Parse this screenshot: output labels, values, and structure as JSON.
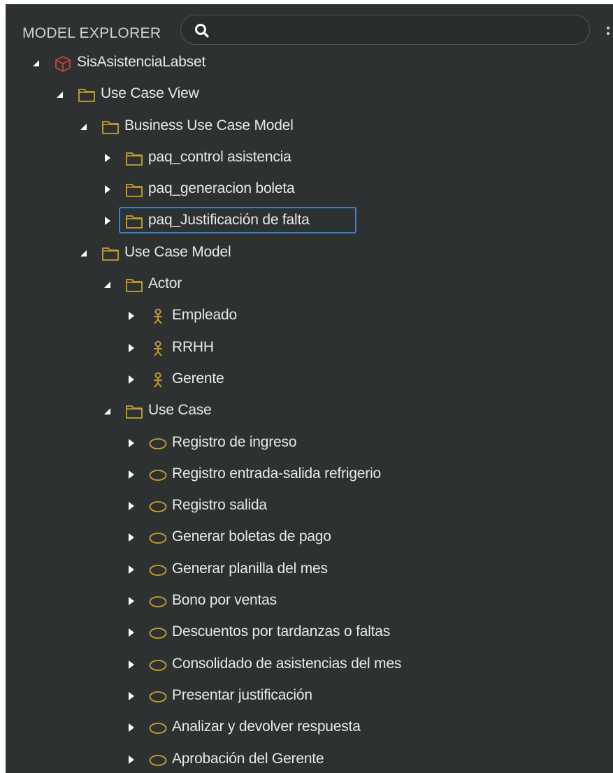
{
  "header": {
    "title": "MODEL EXPLORER",
    "search": {
      "value": "",
      "placeholder": ""
    }
  },
  "colors": {
    "panel_bg": "#2e3132",
    "folder": "#c9a227",
    "actor": "#c9a227",
    "use_case": "#c9a227",
    "project": "#d0453a",
    "selection": "#3a82c8"
  },
  "tree": [
    {
      "label": "SisAsistenciaLabset",
      "icon": "project-icon",
      "depth": 0,
      "expanded": true
    },
    {
      "label": "Use Case View",
      "icon": "folder-icon",
      "depth": 1,
      "expanded": true
    },
    {
      "label": "Business Use Case Model",
      "icon": "folder-icon",
      "depth": 2,
      "expanded": true
    },
    {
      "label": "paq_control asistencia",
      "icon": "folder-icon",
      "depth": 3,
      "expanded": false
    },
    {
      "label": "paq_generacion boleta",
      "icon": "folder-icon",
      "depth": 3,
      "expanded": false
    },
    {
      "label": "paq_Justificación de falta",
      "icon": "folder-icon",
      "depth": 3,
      "expanded": false,
      "selected": true
    },
    {
      "label": "Use Case Model",
      "icon": "folder-icon",
      "depth": 2,
      "expanded": true
    },
    {
      "label": "Actor",
      "icon": "folder-icon",
      "depth": 3,
      "expanded": true
    },
    {
      "label": "Empleado",
      "icon": "actor-icon",
      "depth": 4,
      "expanded": false
    },
    {
      "label": "RRHH",
      "icon": "actor-icon",
      "depth": 4,
      "expanded": false
    },
    {
      "label": "Gerente",
      "icon": "actor-icon",
      "depth": 4,
      "expanded": false
    },
    {
      "label": "Use Case",
      "icon": "folder-icon",
      "depth": 3,
      "expanded": true
    },
    {
      "label": "Registro de ingreso",
      "icon": "use-case-icon",
      "depth": 4,
      "expanded": false
    },
    {
      "label": "Registro entrada-salida refrigerio",
      "icon": "use-case-icon",
      "depth": 4,
      "expanded": false
    },
    {
      "label": "Registro salida",
      "icon": "use-case-icon",
      "depth": 4,
      "expanded": false
    },
    {
      "label": "Generar boletas de pago",
      "icon": "use-case-icon",
      "depth": 4,
      "expanded": false
    },
    {
      "label": "Generar planilla del mes",
      "icon": "use-case-icon",
      "depth": 4,
      "expanded": false
    },
    {
      "label": "Bono por ventas",
      "icon": "use-case-icon",
      "depth": 4,
      "expanded": false
    },
    {
      "label": "Descuentos por tardanzas o faltas",
      "icon": "use-case-icon",
      "depth": 4,
      "expanded": false
    },
    {
      "label": "Consolidado de asistencias del mes",
      "icon": "use-case-icon",
      "depth": 4,
      "expanded": false
    },
    {
      "label": "Presentar justificación",
      "icon": "use-case-icon",
      "depth": 4,
      "expanded": false
    },
    {
      "label": "Analizar y devolver respuesta",
      "icon": "use-case-icon",
      "depth": 4,
      "expanded": false
    },
    {
      "label": "Aprobación del Gerente",
      "icon": "use-case-icon",
      "depth": 4,
      "expanded": false
    }
  ]
}
